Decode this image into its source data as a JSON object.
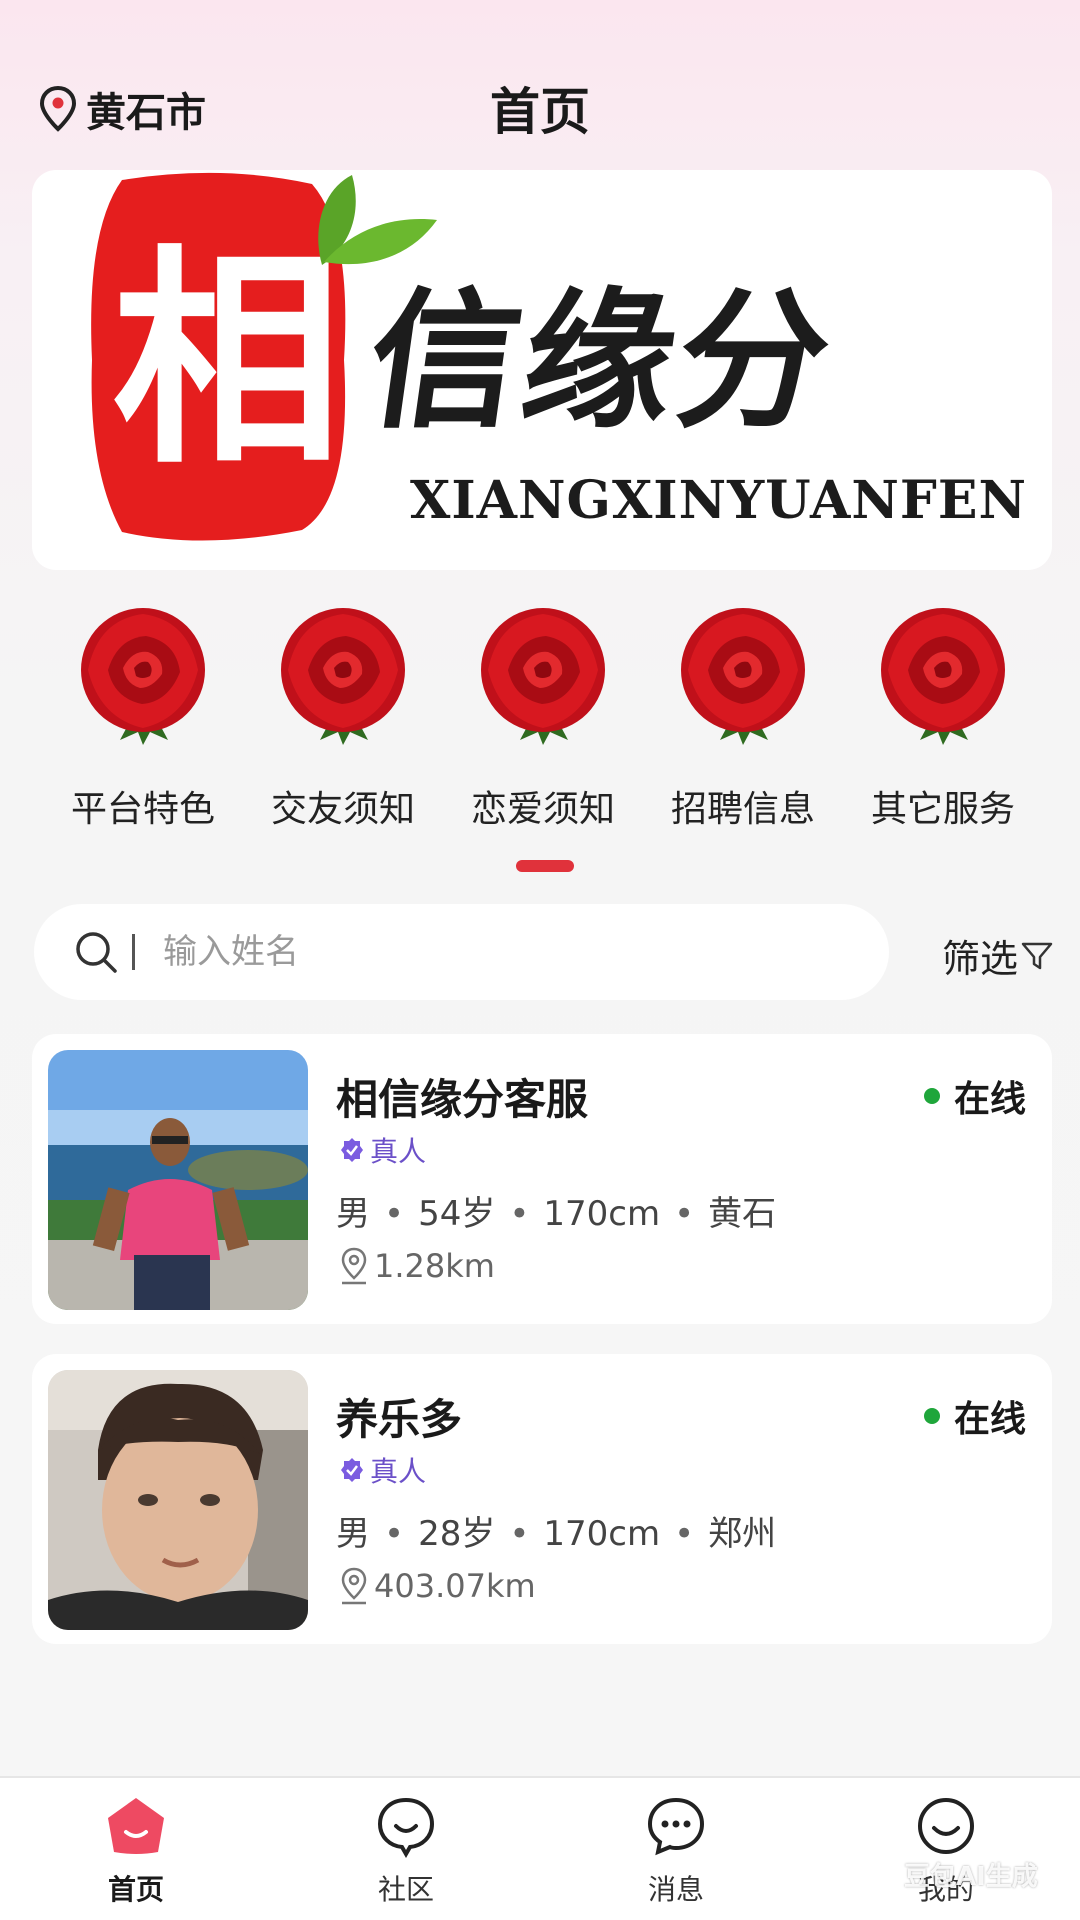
{
  "header": {
    "location": "黄石市",
    "title": "首页"
  },
  "banner": {
    "seal_char": "相",
    "brand_cn": "信缘分",
    "brand_en": "XIANGXINYUANFEN"
  },
  "categories": [
    {
      "label": "平台特色",
      "icon": "rose-icon"
    },
    {
      "label": "交友须知",
      "icon": "rose-icon"
    },
    {
      "label": "恋爱须知",
      "icon": "rose-icon"
    },
    {
      "label": "招聘信息",
      "icon": "rose-icon"
    },
    {
      "label": "其它服务",
      "icon": "rose-icon"
    }
  ],
  "search": {
    "placeholder": "输入姓名",
    "value": "",
    "filter_label": "筛选"
  },
  "users": [
    {
      "name": "相信缘分客服",
      "status": "在线",
      "verified": "真人",
      "gender": "男",
      "age": "54岁",
      "height": "170cm",
      "city": "黄石",
      "distance": "1.28km"
    },
    {
      "name": "养乐多",
      "status": "在线",
      "verified": "真人",
      "gender": "男",
      "age": "28岁",
      "height": "170cm",
      "city": "郑州",
      "distance": "403.07km"
    }
  ],
  "tabs": [
    {
      "label": "首页",
      "icon": "home-icon",
      "active": true
    },
    {
      "label": "社区",
      "icon": "community-icon",
      "active": false
    },
    {
      "label": "消息",
      "icon": "message-icon",
      "active": false
    },
    {
      "label": "我的",
      "icon": "profile-icon",
      "active": false
    }
  ],
  "watermark": "豆包AI生成",
  "colors": {
    "accent": "#e0323b",
    "online": "#1fa63b",
    "verified": "#6b50c8"
  }
}
